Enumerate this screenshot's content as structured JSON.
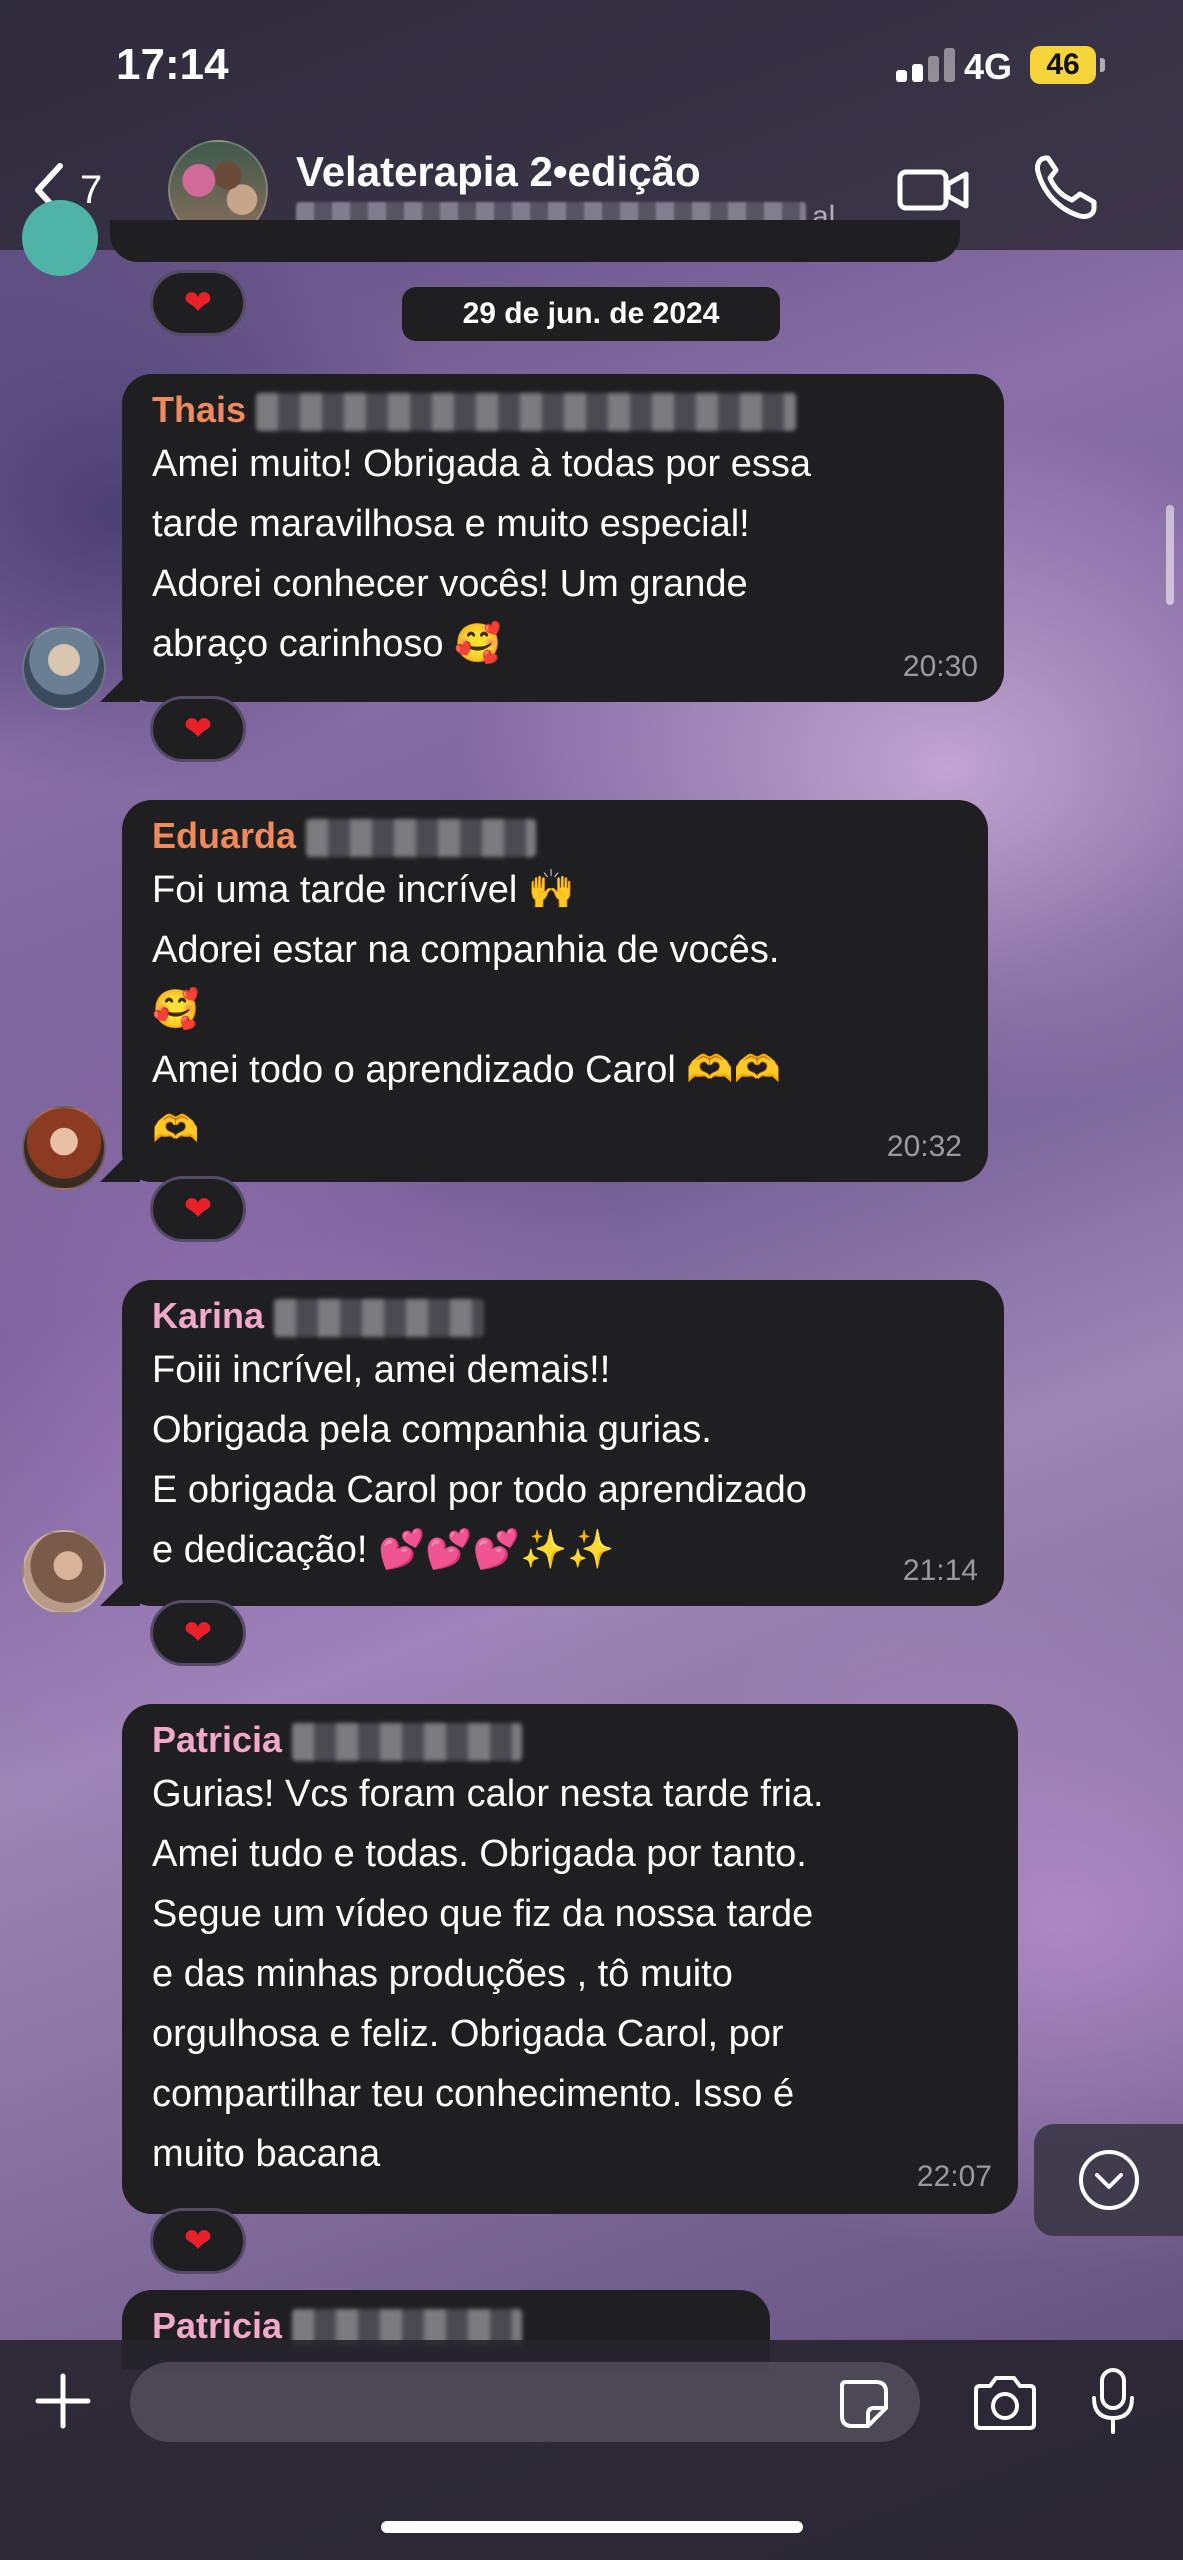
{
  "status_bar": {
    "time": "17:14",
    "network": "4G",
    "battery": "46"
  },
  "header": {
    "back_count": "7",
    "title": "Velaterapia 2•edição",
    "subtitle_suffix": "al..."
  },
  "date_chip": "29 de jun. de 2024",
  "messages": [
    {
      "sender": "Thais",
      "sender_color": "#f08a5d",
      "lines": [
        "Amei muito! Obrigada à todas por essa",
        "tarde maravilhosa e muito especial!",
        "Adorei conhecer vocês! Um grande",
        "abraço carinhoso 🥰"
      ],
      "time": "20:30",
      "reaction": "❤"
    },
    {
      "sender": "Eduarda",
      "sender_color": "#f08a5d",
      "lines": [
        "Foi uma tarde incrível 🙌",
        "Adorei estar na  companhia de vocês.",
        "🥰",
        "Amei todo o aprendizado Carol 🫶🫶",
        "🫶"
      ],
      "time": "20:32",
      "reaction": "❤"
    },
    {
      "sender": "Karina",
      "sender_color": "#f2a8c8",
      "lines": [
        "Foiii incrível, amei demais!!",
        "Obrigada pela companhia gurias.",
        "E obrigada Carol por todo aprendizado",
        "e dedicação! 💕💕💕✨✨"
      ],
      "time": "21:14",
      "reaction": "❤"
    },
    {
      "sender": "Patricia",
      "sender_color": "#f2a8c8",
      "lines": [
        "Gurias! Vcs foram calor nesta tarde fria.",
        "Amei tudo e todas. Obrigada por tanto.",
        "Segue um vídeo que fiz da nossa tarde",
        "e das minhas produções , tô muito",
        "orgulhosa e feliz. Obrigada Carol, por",
        "compartilhar teu conhecimento. Isso é",
        "muito bacana"
      ],
      "time": "22:07",
      "reaction": "❤"
    },
    {
      "sender": "Patricia",
      "sender_color": "#f2a8c8"
    }
  ],
  "top_reaction": "❤",
  "icons": [
    "chevron-left-icon",
    "video-camera-icon",
    "phone-icon",
    "chevron-down-icon",
    "plus-icon",
    "sticker-icon",
    "camera-icon",
    "microphone-icon"
  ]
}
